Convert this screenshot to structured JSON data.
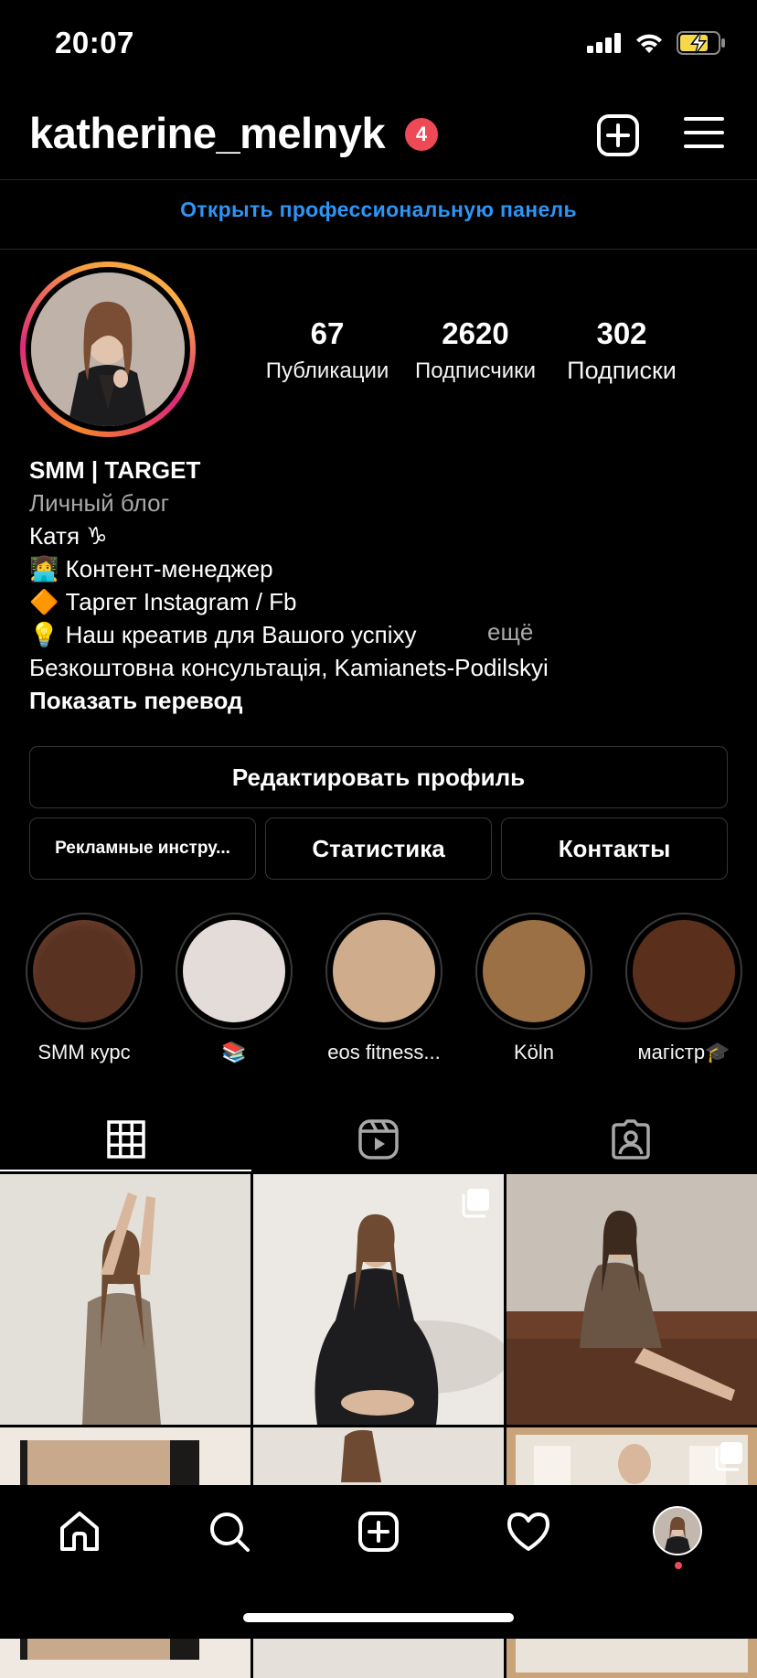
{
  "status_bar": {
    "time": "20:07"
  },
  "header": {
    "username": "katherine_melnyk",
    "notification_count": "4"
  },
  "pro_panel_link": "Открыть профессиональную панель",
  "stats": [
    {
      "value": "67",
      "label": "Публикации"
    },
    {
      "value": "2620",
      "label": "Подписчики"
    },
    {
      "value": "302",
      "label": "Подписки"
    }
  ],
  "bio": {
    "name": "SMM | TARGET",
    "category": "Личный блог",
    "lines": [
      "Катя ♑",
      "👩‍💻 Контент-менеджер",
      "🔶 Таргет Instagram / Fb",
      "💡 Наш креатив для Вашого успіху",
      "Безкоштовна консультація, Kamianets-Podilskyi"
    ],
    "more": "ещё",
    "translate": "Показать перевод"
  },
  "buttons": {
    "edit_profile": "Редактировать профиль",
    "ads_tools": "Рекламные инстру...",
    "statistics": "Статистика",
    "contacts": "Контакты"
  },
  "highlights": [
    {
      "label": "SMM курс",
      "color": "#5a3222"
    },
    {
      "label": "📚",
      "color": "#e3dcd8"
    },
    {
      "label": "eos fitness...",
      "color": "#cfac8c"
    },
    {
      "label": "Köln",
      "color": "#9b7045"
    },
    {
      "label": "магістр🎓",
      "color": "#5a2f1c"
    }
  ],
  "tabs": [
    "grid-icon",
    "reels-icon",
    "tagged-icon"
  ],
  "bottom_nav": [
    "home-icon",
    "search-icon",
    "create-icon",
    "activity-icon",
    "profile-avatar"
  ],
  "colors": {
    "accent_link": "#2c95f6",
    "badge": "#ed4956",
    "background": "#000000"
  }
}
